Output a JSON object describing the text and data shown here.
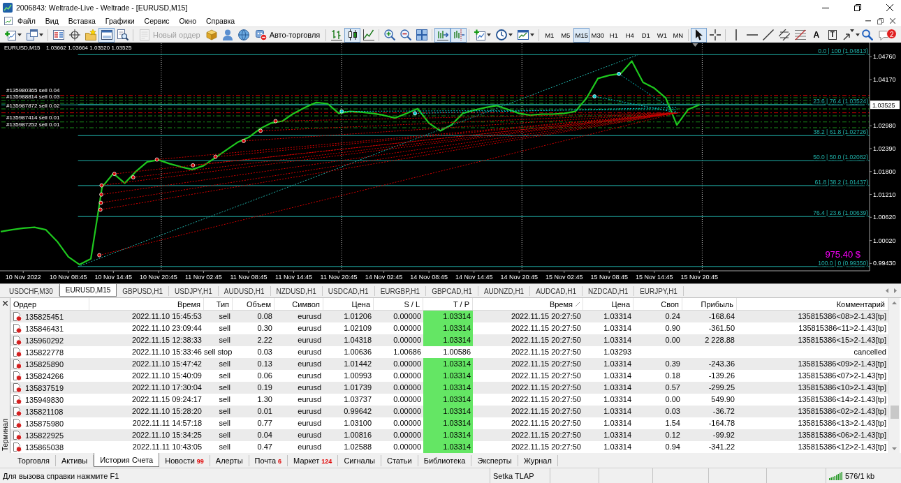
{
  "window": {
    "title": "2006843: Weltrade-Live - Weltrade - [EURUSD,M15]"
  },
  "menu": [
    "Файл",
    "Вид",
    "Вставка",
    "Графики",
    "Сервис",
    "Окно",
    "Справка"
  ],
  "toolbar": {
    "terminal_panel": {
      "on": true
    },
    "new_order": {
      "label": "Новый ордер",
      "disabled": true
    },
    "auto_trading": {
      "label": "Авто-торговля"
    },
    "chart_modes": [
      {
        "selected": false
      },
      {
        "selected": true
      },
      {
        "selected": false
      }
    ],
    "autoscroll": {
      "on": true
    },
    "chart_shift": {
      "on": true
    },
    "periods": [
      {
        "label": "M1",
        "selected": false
      },
      {
        "label": "M5",
        "selected": false
      },
      {
        "label": "M15",
        "selected": true
      },
      {
        "label": "M30",
        "selected": false
      },
      {
        "label": "H1",
        "selected": false
      },
      {
        "label": "H4",
        "selected": false
      },
      {
        "label": "D1",
        "selected": false
      },
      {
        "label": "W1",
        "selected": false
      },
      {
        "label": "MN",
        "selected": false
      }
    ],
    "tools": [
      {
        "selected": true
      },
      {
        "selected": false
      },
      {
        "selected": false
      },
      {
        "selected": false
      },
      {
        "selected": false
      },
      {
        "selected": false
      },
      {
        "selected": false
      },
      {
        "glyph": "A",
        "selected": false
      },
      {
        "glyph": "T",
        "selected": false
      },
      {
        "selected": false
      }
    ],
    "notifications": "2"
  },
  "chart": {
    "symbol": "EURUSD,M15",
    "prices": "1.03662 1.03664 1.03520 1.03525",
    "bid": "1.03525",
    "profit": "975.40 $",
    "chart_data": [
      {
        "type": "line",
        "color": "#1ec81e",
        "grid": "x",
        "categories": [
          null,
          null,
          "10 Nov 2022",
          null,
          null,
          null,
          "10 Nov 08:45",
          null,
          null,
          null,
          "10 Nov 14:45",
          null,
          null,
          null,
          "10 Nov 20:45",
          null,
          null,
          null,
          "11 Nov 02:45",
          null,
          null,
          null,
          "11 Nov 08:45",
          null,
          null,
          null,
          "11 Nov 14:45",
          null,
          null,
          null,
          "11 Nov 20:45",
          null,
          null,
          null,
          "14 Nov 02:45",
          null,
          null,
          null,
          "14 Nov 08:45",
          null,
          null,
          null,
          "14 Nov 14:45",
          null,
          null,
          null,
          "14 Nov 20:45",
          null,
          null,
          null,
          "15 Nov 02:45",
          null,
          null,
          null,
          "15 Nov 08:45",
          null,
          null,
          null,
          "15 Nov 14:45",
          null,
          null,
          null,
          "15 Nov 20:45"
        ],
        "values": [
          1.0025,
          1.003,
          1.0034,
          1.0036,
          1.003,
          1.0,
          0.996,
          0.994,
          0.9955,
          1.014,
          1.0175,
          1.015,
          1.018,
          1.0205,
          1.021,
          1.02,
          1.0192,
          1.0185,
          1.0195,
          1.0215,
          1.0235,
          1.0255,
          1.0268,
          1.029,
          1.0305,
          1.031,
          1.033,
          1.0345,
          1.0358,
          1.0355,
          1.033,
          1.0335,
          1.0333,
          1.033,
          1.0325,
          1.0318,
          1.033,
          1.0342,
          1.0305,
          1.0285,
          1.03,
          1.033,
          1.0338,
          1.0345,
          1.035,
          1.034,
          1.033,
          1.0325,
          1.0328,
          1.0328,
          1.033,
          1.0335,
          1.037,
          1.042,
          1.0428,
          1.0432,
          1.0465,
          1.041,
          1.0395,
          1.037,
          1.03,
          1.034,
          1.0352
        ],
        "ylim": [
          0.99239,
          1.05107
        ],
        "yticks": [
          {
            "value": 0.9943,
            "label": "0.99430"
          },
          {
            "value": 1.0002,
            "label": "1.00020"
          },
          {
            "value": 1.0062,
            "label": "1.00620"
          },
          {
            "value": 1.0121,
            "label": "1.01210"
          },
          {
            "value": 1.018,
            "label": "1.01800"
          },
          {
            "value": 1.0239,
            "label": "1.02390"
          },
          {
            "value": 1.0298,
            "label": "1.02980"
          },
          {
            "value": 1.0417,
            "label": "1.04170"
          },
          {
            "value": 1.0476,
            "label": "1.04760"
          }
        ],
        "ref_lines": [
          {
            "axis": "y",
            "value": 1.04813,
            "label": "0.0 | 100 (1.04813)",
            "color": "#20b2aa",
            "line_style": "solid"
          },
          {
            "axis": "y",
            "value": 1.03524,
            "label": "23.6 | 76.4 (1.03524)",
            "color": "#20b2aa",
            "line_style": "solid"
          },
          {
            "axis": "y",
            "value": 1.02726,
            "label": "38.2 | 61.8 (1.02726)",
            "color": "#20b2aa",
            "line_style": "solid"
          },
          {
            "axis": "y",
            "value": 1.02082,
            "label": "50.0 | 50.0 (1.02082)",
            "color": "#20b2aa",
            "line_style": "solid"
          },
          {
            "axis": "y",
            "value": 1.01437,
            "label": "61.8 |38.2 (1.01437)",
            "color": "#20b2aa",
            "line_style": "solid"
          },
          {
            "axis": "y",
            "value": 1.00639,
            "label": "76.4 | 23.6 (1.00639)",
            "color": "#20b2aa",
            "line_style": "solid"
          },
          {
            "axis": "y",
            "value": 0.9935,
            "label": "100.0 | 0 (0.99350)",
            "color": "#20b2aa",
            "line_style": "solid"
          },
          {
            "axis": "y",
            "value": 1.03762,
            "label": "#135980365 sell 0.04",
            "color": "#d40000",
            "line_style": "dashdot"
          },
          {
            "axis": "y",
            "value": 1.03703,
            "color": "#1a8c1a",
            "line_style": "dashdot"
          },
          {
            "axis": "y",
            "value": 1.03636,
            "label": "#135988814 sell 0.03",
            "color": "#1a8c1a",
            "line_style": "dashdot"
          },
          {
            "axis": "y",
            "value": 1.03559,
            "color": "#1a8c1a",
            "line_style": "dashdot"
          },
          {
            "axis": "y",
            "value": 1.03415,
            "label": "#135987872 sell 0.02",
            "color": "#1a8c1a",
            "line_style": "dashdot"
          },
          {
            "axis": "y",
            "value": 1.03314,
            "color": "#d40000",
            "line_style": "dashdot"
          },
          {
            "axis": "y",
            "value": 1.03235,
            "color": "#1a8c1a",
            "line_style": "dashdot"
          },
          {
            "axis": "y",
            "value": 1.03078,
            "label": "#135987414 sell 0.01",
            "color": "#1a8c1a",
            "line_style": "dashdot"
          },
          {
            "axis": "y",
            "value": 1.02929,
            "label": "#135987252 sell 0.01",
            "color": "#1a8c1a",
            "line_style": "dashdot"
          }
        ]
      }
    ]
  },
  "chart_tabs": [
    {
      "label": "USDCHF,M30",
      "selected": false
    },
    {
      "label": "EURUSD,M15",
      "selected": true
    },
    {
      "label": "GBPUSD,H1",
      "selected": false
    },
    {
      "label": "USDJPY,H1",
      "selected": false
    },
    {
      "label": "AUDUSD,H1",
      "selected": false
    },
    {
      "label": "NZDUSD,H1",
      "selected": false
    },
    {
      "label": "USDCAD,H1",
      "selected": false
    },
    {
      "label": "EURGBP,H1",
      "selected": false
    },
    {
      "label": "GBPCAD,H1",
      "selected": false
    },
    {
      "label": "AUDNZD,H1",
      "selected": false
    },
    {
      "label": "AUDCAD,H1",
      "selected": false
    },
    {
      "label": "NZDCAD,H1",
      "selected": false
    },
    {
      "label": "EURJPY,H1",
      "selected": false
    }
  ],
  "terminal": {
    "title": "Терминал",
    "columns": [
      {
        "label": "Ордер",
        "sorted": false
      },
      {
        "label": "Время",
        "sorted": false
      },
      {
        "label": "Тип",
        "sorted": false
      },
      {
        "label": "Объем",
        "sorted": false
      },
      {
        "label": "Символ",
        "sorted": false
      },
      {
        "label": "Цена",
        "sorted": false
      },
      {
        "label": "S / L",
        "sorted": false
      },
      {
        "label": "T / P",
        "sorted": false
      },
      {
        "label": "Время",
        "sorted": true
      },
      {
        "label": "Цена",
        "sorted": false
      },
      {
        "label": "Своп",
        "sorted": false
      },
      {
        "label": "Прибыль",
        "sorted": false
      },
      {
        "label": "Комментарий",
        "sorted": false
      }
    ],
    "rows": [
      {
        "cells": [
          "135825451",
          "2022.11.10 15:45:53",
          "sell",
          "0.08",
          "eurusd",
          "1.01206",
          "0.00000",
          "1.03314",
          "2022.11.15 20:27:50",
          "1.03314",
          "0.24",
          "-168.64",
          "135815386<08>2-1.43[tp]"
        ],
        "tp_hit": true
      },
      {
        "cells": [
          "135846431",
          "2022.11.10 23:09:44",
          "sell",
          "0.30",
          "eurusd",
          "1.02109",
          "0.00000",
          "1.03314",
          "2022.11.15 20:27:50",
          "1.03314",
          "0.90",
          "-361.50",
          "135815386<11>2-1.43[tp]"
        ],
        "tp_hit": true
      },
      {
        "cells": [
          "135960292",
          "2022.11.15 12:38:33",
          "sell",
          "2.22",
          "eurusd",
          "1.04318",
          "0.00000",
          "1.03314",
          "2022.11.15 20:27:50",
          "1.03314",
          "0.00",
          "2 228.88",
          "135815386<15>2-1.43[tp]"
        ],
        "tp_hit": true
      },
      {
        "cells": [
          "135822778",
          "2022.11.10 15:33:46",
          "sell stop",
          "0.03",
          "eurusd",
          "1.00636",
          "1.00686",
          "1.00586",
          "2022.11.15 20:27:50",
          "1.03293",
          null,
          null,
          "cancelled"
        ],
        "tp_hit": false
      },
      {
        "cells": [
          "135825890",
          "2022.11.10 15:47:42",
          "sell",
          "0.13",
          "eurusd",
          "1.01442",
          "0.00000",
          "1.03314",
          "2022.11.15 20:27:50",
          "1.03314",
          "0.39",
          "-243.36",
          "135815386<09>2-1.43[tp]"
        ],
        "tp_hit": true
      },
      {
        "cells": [
          "135824266",
          "2022.11.10 15:40:09",
          "sell",
          "0.06",
          "eurusd",
          "1.00993",
          "0.00000",
          "1.03314",
          "2022.11.15 20:27:50",
          "1.03314",
          "0.18",
          "-139.26",
          "135815386<07>2-1.43[tp]"
        ],
        "tp_hit": true
      },
      {
        "cells": [
          "135837519",
          "2022.11.10 17:30:04",
          "sell",
          "0.19",
          "eurusd",
          "1.01739",
          "0.00000",
          "1.03314",
          "2022.11.15 20:27:50",
          "1.03314",
          "0.57",
          "-299.25",
          "135815386<10>2-1.43[tp]"
        ],
        "tp_hit": true
      },
      {
        "cells": [
          "135949830",
          "2022.11.15 09:24:17",
          "sell",
          "1.30",
          "eurusd",
          "1.03737",
          "0.00000",
          "1.03314",
          "2022.11.15 20:27:50",
          "1.03314",
          "0.00",
          "549.90",
          "135815386<14>2-1.43[tp]"
        ],
        "tp_hit": true
      },
      {
        "cells": [
          "135821108",
          "2022.11.10 15:28:20",
          "sell",
          "0.01",
          "eurusd",
          "0.99642",
          "0.00000",
          "1.03314",
          "2022.11.15 20:27:50",
          "1.03314",
          "0.03",
          "-36.72",
          "135815386<02>2-1.43[tp]"
        ],
        "tp_hit": true
      },
      {
        "cells": [
          "135875980",
          "2022.11.11 14:57:18",
          "sell",
          "0.77",
          "eurusd",
          "1.03100",
          "0.00000",
          "1.03314",
          "2022.11.15 20:27:50",
          "1.03314",
          "1.54",
          "-164.78",
          "135815386<13>2-1.43[tp]"
        ],
        "tp_hit": true
      },
      {
        "cells": [
          "135822925",
          "2022.11.10 15:34:25",
          "sell",
          "0.04",
          "eurusd",
          "1.00816",
          "0.00000",
          "1.03314",
          "2022.11.15 20:27:50",
          "1.03314",
          "0.12",
          "-99.92",
          "135815386<06>2-1.43[tp]"
        ],
        "tp_hit": true
      },
      {
        "cells": [
          "135865038",
          "2022.11.11 10:43:05",
          "sell",
          "0.47",
          "eurusd",
          "1.02588",
          "0.00000",
          "1.03314",
          "2022.11.15 20:27:50",
          "1.03314",
          "0.94",
          "-341.22",
          "135815386<12>2-1.43[tp]"
        ],
        "tp_hit": true
      }
    ],
    "tabs": [
      {
        "label": "Торговля",
        "selected": false
      },
      {
        "label": "Активы",
        "selected": false
      },
      {
        "label": "История Счета",
        "selected": true
      },
      {
        "label": "Новости",
        "badge": "99",
        "selected": false
      },
      {
        "label": "Алерты",
        "selected": false
      },
      {
        "label": "Почта",
        "badge": "6",
        "selected": false
      },
      {
        "label": "Маркет",
        "badge": "124",
        "selected": false
      },
      {
        "label": "Сигналы",
        "selected": false
      },
      {
        "label": "Статьи",
        "selected": false
      },
      {
        "label": "Библиотека",
        "selected": false
      },
      {
        "label": "Эксперты",
        "selected": false
      },
      {
        "label": "Журнал",
        "selected": false
      }
    ]
  },
  "status_bar": {
    "help": "Для вызова справки нажмите F1",
    "profile": "Setka TLAP",
    "traffic": "576/1 kb"
  }
}
